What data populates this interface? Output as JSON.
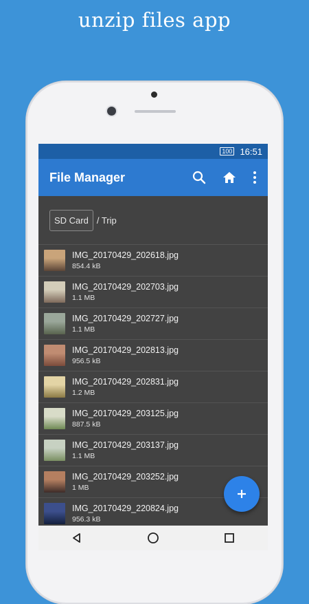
{
  "promo": {
    "headline": "unzip files app"
  },
  "status_bar": {
    "battery": "100",
    "time": "16:51"
  },
  "app_bar": {
    "title": "File Manager",
    "actions": [
      {
        "icon": "search-icon"
      },
      {
        "icon": "home-icon"
      },
      {
        "icon": "more-vert-icon"
      }
    ]
  },
  "breadcrumb": {
    "root": "SD Card",
    "path": "/ Trip"
  },
  "files": [
    {
      "name": "IMG_20170429_202618.jpg",
      "size": "854.4 kB",
      "thumb_colors": [
        "#c9a47a",
        "#5b4537"
      ]
    },
    {
      "name": "IMG_20170429_202703.jpg",
      "size": "1.1 MB",
      "thumb_colors": [
        "#d3cdb9",
        "#7f6a5b"
      ]
    },
    {
      "name": "IMG_20170429_202727.jpg",
      "size": "1.1 MB",
      "thumb_colors": [
        "#9aa79a",
        "#58634e"
      ]
    },
    {
      "name": "IMG_20170429_202813.jpg",
      "size": "956.5 kB",
      "thumb_colors": [
        "#c08c72",
        "#7c4b3b"
      ]
    },
    {
      "name": "IMG_20170429_202831.jpg",
      "size": "1.2 MB",
      "thumb_colors": [
        "#e3d4a5",
        "#8b7a45"
      ]
    },
    {
      "name": "IMG_20170429_203125.jpg",
      "size": "887.5 kB",
      "thumb_colors": [
        "#d8dcc8",
        "#6f8a55"
      ]
    },
    {
      "name": "IMG_20170429_203137.jpg",
      "size": "1.1 MB",
      "thumb_colors": [
        "#c7d1c2",
        "#7a8f62"
      ]
    },
    {
      "name": "IMG_20170429_203252.jpg",
      "size": "1 MB",
      "thumb_colors": [
        "#b47f60",
        "#3d2c28"
      ]
    },
    {
      "name": "IMG_20170429_220824.jpg",
      "size": "956.3 kB",
      "thumb_colors": [
        "#3c4f8c",
        "#14203d"
      ]
    }
  ],
  "fab": {
    "icon": "add-icon"
  },
  "nav_bar": {
    "buttons": [
      "back-icon",
      "home-nav-icon",
      "recents-icon"
    ]
  },
  "colors": {
    "background": "#3d93d8",
    "status_bar": "#1d5fa6",
    "app_bar": "#2d7ad0",
    "list_background": "#424242",
    "fab": "#2d82e8"
  }
}
